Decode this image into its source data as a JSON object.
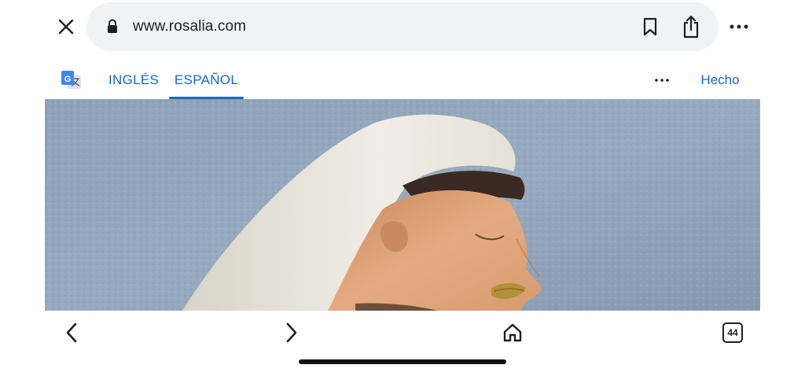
{
  "browser": {
    "url": "www.rosalia.com"
  },
  "translate": {
    "tabs": [
      {
        "label": "INGLÉS",
        "selected": false
      },
      {
        "label": "ESPAÑOL",
        "selected": true
      }
    ],
    "done_label": "Hecho"
  },
  "toolbar": {
    "tab_count": "44"
  },
  "icons": {
    "close": "close-icon",
    "lock": "lock-icon",
    "bookmark": "bookmark-icon",
    "share": "share-icon",
    "more": "more-horizontal-icon",
    "translate_logo": "google-translate-icon",
    "back": "chevron-left-icon",
    "forward": "chevron-right-icon",
    "home": "home-icon",
    "tabs": "tabs-icon"
  },
  "colors": {
    "accent": "#1a66c7",
    "url_bar_bg": "#f1f2f4",
    "icon": "#1f1f1f"
  }
}
